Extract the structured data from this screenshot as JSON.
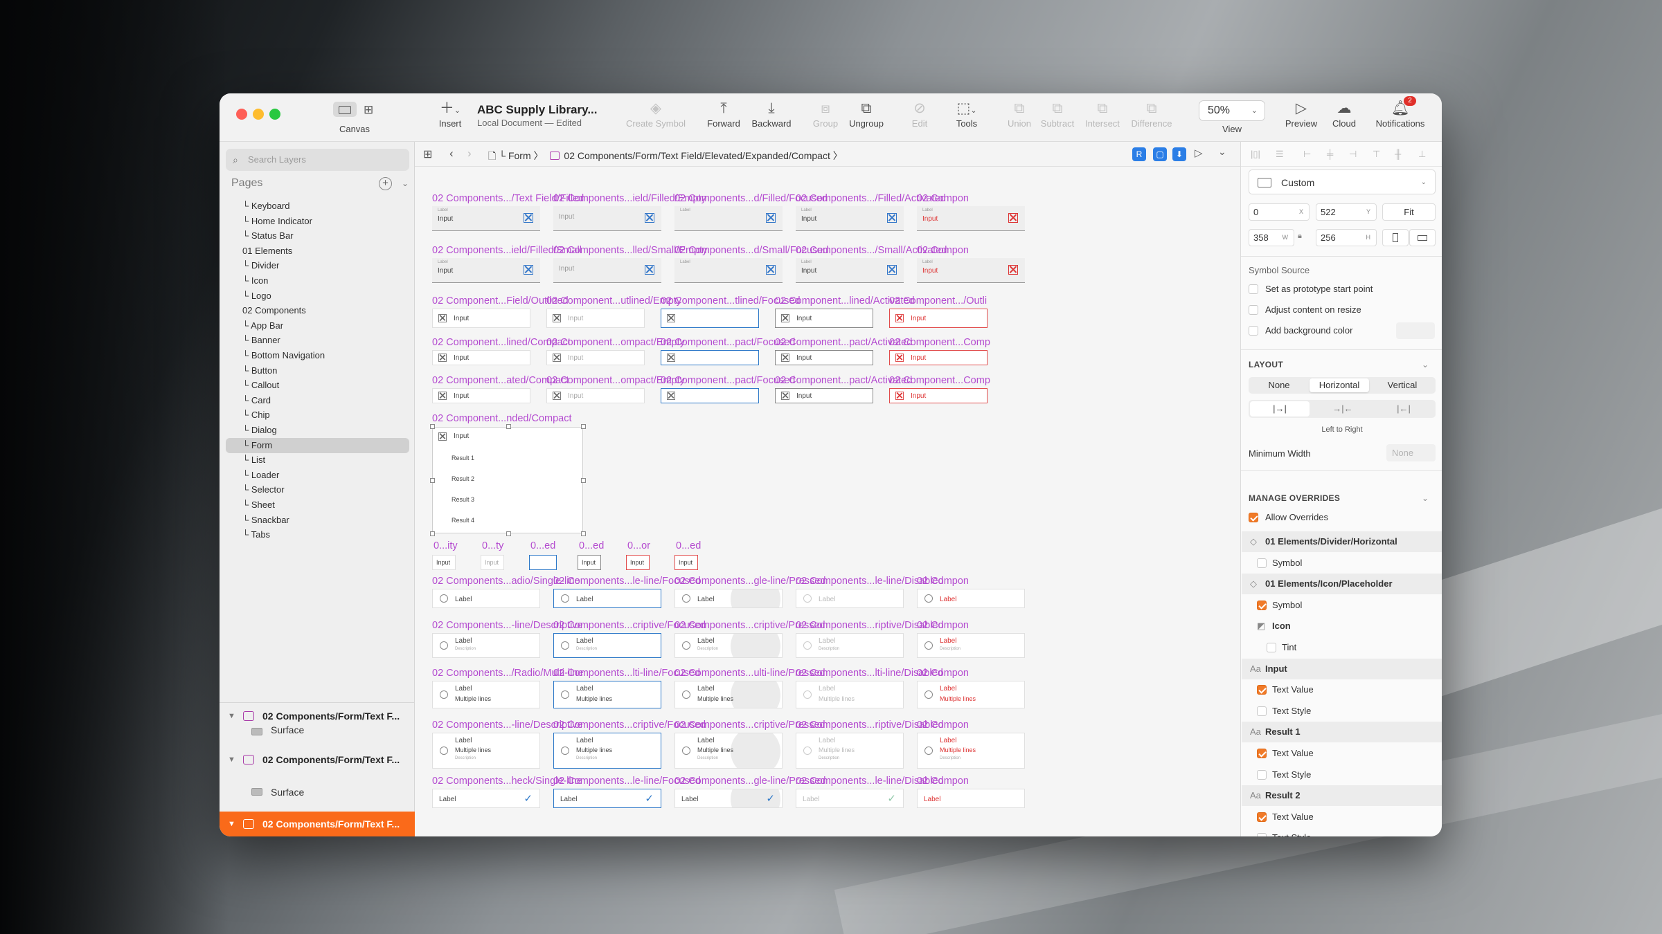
{
  "app": {
    "document_title": "ABC Supply Library...",
    "document_subtitle": "Local Document — Edited",
    "canvas_label": "Canvas",
    "search_placeholder": "Search Layers"
  },
  "toolbar": {
    "insert": "Insert",
    "create_symbol": "Create Symbol",
    "forward": "Forward",
    "backward": "Backward",
    "group": "Group",
    "ungroup": "Ungroup",
    "edit": "Edit",
    "tools": "Tools",
    "union": "Union",
    "subtract": "Subtract",
    "intersect": "Intersect",
    "difference": "Difference",
    "zoom": "50%",
    "view": "View",
    "preview": "Preview",
    "cloud": "Cloud",
    "notifications": "Notifications",
    "notification_count": "2"
  },
  "sidebar": {
    "pages_title": "Pages",
    "pages": [
      "Keyboard",
      "Home Indicator",
      "Status Bar",
      "01 Elements",
      "Divider",
      "Icon",
      "Logo",
      "02 Components",
      "App Bar",
      "Banner",
      "Bottom Navigation",
      "Button",
      "Callout",
      "Card",
      "Chip",
      "Dialog",
      "Form",
      "List",
      "Loader",
      "Selector",
      "Sheet",
      "Snackbar",
      "Tabs"
    ],
    "page_prefix": "└ ",
    "layers": [
      {
        "name": "02 Components/Form/Text F...",
        "child": "Surface"
      },
      {
        "name": "02 Components/Form/Text F...",
        "child": "Surface"
      },
      {
        "name": "02 Components/Form/Text F..."
      }
    ]
  },
  "breadcrumb": {
    "form": "└ Form",
    "path": "02 Components/Form/Text Field/Elevated/Expanded/Compact"
  },
  "canvas": {
    "input": "Input",
    "label": "Label",
    "label_small": "Label",
    "description": "Description",
    "multiple_lines": "Multiple lines",
    "results": [
      "Result 1",
      "Result 2",
      "Result 3",
      "Result 4"
    ],
    "rows1": [
      [
        "02 Components.../Text Field/Filled",
        "02 Components...ield/Filled/Empty",
        "02 Components...d/Filled/Focused",
        "02 Components.../Filled/Activated",
        "02 Compon"
      ],
      [
        "02 Components...ield/Filled/Small",
        "02 Components...lled/Small/Empty",
        "02 Components...d/Small/Focused",
        "02 Components.../Small/Activated",
        "02 Compon"
      ]
    ],
    "rows2": [
      [
        "02 Component...Field/Outlined",
        "02 Component...utlined/Empty",
        "02 Component...tlined/Focused",
        "02 Component...lined/Activated",
        "02 Component.../Outli"
      ],
      [
        "02 Component...lined/Compact",
        "02 Component...ompact/Empty",
        "02 Component...pact/Focused",
        "02 Component...pact/Activated",
        "02 Component...Comp"
      ],
      [
        "02 Component...ated/Compact",
        "02 Component...ompact/Empty",
        "02 Component...pact/Focused",
        "02 Component...pact/Activated",
        "02 Component...Comp"
      ]
    ],
    "expanded_label": "02 Component...nded/Compact",
    "small_labels": [
      "0...ity",
      "0...ty",
      "0...ed",
      "0...ed",
      "0...or",
      "0...ed"
    ],
    "rows3": [
      [
        "02 Components...adio/Single-line",
        "02 Components...le-line/Focused",
        "02 Components...gle-line/Pressed",
        "02 Components...le-line/Disabled",
        "02 Compon"
      ],
      [
        "02 Components...-line/Descriptive",
        "02 Components...criptive/Focused",
        "02 Components...criptive/Pressed",
        "02 Components...riptive/Disabled",
        "02 Compon"
      ],
      [
        "02 Components.../Radio/Multi-line",
        "02 Components...lti-line/Focused",
        "02 Components...ulti-line/Pressed",
        "02 Components...lti-line/Disabled",
        "02 Compon"
      ],
      [
        "02 Components...-line/Descriptive",
        "02 Components...criptive/Focused",
        "02 Components...criptive/Pressed",
        "02 Components...riptive/Disabled",
        "02 Compon"
      ],
      [
        "02 Components...heck/Single-line",
        "02 Components...le-line/Focused",
        "02 Components...gle-line/Pressed",
        "02 Components...le-line/Disabled",
        "02 Compon"
      ]
    ]
  },
  "inspector": {
    "preset": "Custom",
    "x": "0",
    "x_unit": "X",
    "y": "522",
    "y_unit": "Y",
    "fit": "Fit",
    "w": "358",
    "w_unit": "W",
    "h": "256",
    "h_unit": "H",
    "symbol_source": "Symbol Source",
    "set_prototype": "Set as prototype start point",
    "adjust_content": "Adjust content on resize",
    "add_background": "Add background color",
    "layout_title": "LAYOUT",
    "layout_options": [
      "None",
      "Horizontal",
      "Vertical"
    ],
    "direction": "Left to Right",
    "min_width_label": "Minimum Width",
    "min_width_value": "None",
    "overrides_title": "MANAGE OVERRIDES",
    "allow_overrides": "Allow Overrides",
    "overrides": [
      {
        "type": "head",
        "glyph": "◇",
        "text": "01 Elements/Divider/Horizontal"
      },
      {
        "type": "check",
        "checked": false,
        "text": "Symbol"
      },
      {
        "type": "head",
        "glyph": "◇",
        "text": "01 Elements/Icon/Placeholder"
      },
      {
        "type": "check",
        "checked": true,
        "text": "Symbol"
      },
      {
        "type": "sub",
        "glyph": "◩",
        "text": "Icon"
      },
      {
        "type": "check",
        "checked": false,
        "text": "Tint",
        "deep": true
      },
      {
        "type": "head",
        "glyph": "Aa",
        "text": "Input"
      },
      {
        "type": "check",
        "checked": true,
        "text": "Text Value"
      },
      {
        "type": "check",
        "checked": false,
        "text": "Text Style"
      },
      {
        "type": "head",
        "glyph": "Aa",
        "text": "Result 1"
      },
      {
        "type": "check",
        "checked": true,
        "text": "Text Value"
      },
      {
        "type": "check",
        "checked": false,
        "text": "Text Style"
      },
      {
        "type": "head",
        "glyph": "Aa",
        "text": "Result 2"
      },
      {
        "type": "check",
        "checked": true,
        "text": "Text Value"
      },
      {
        "type": "check",
        "checked": false,
        "text": "Text Style"
      }
    ]
  },
  "colors": {
    "accent": "#fa6a1a",
    "label_purple": "#b44bd0",
    "focus_blue": "#2d78c8",
    "error_red": "#e14b4b"
  }
}
